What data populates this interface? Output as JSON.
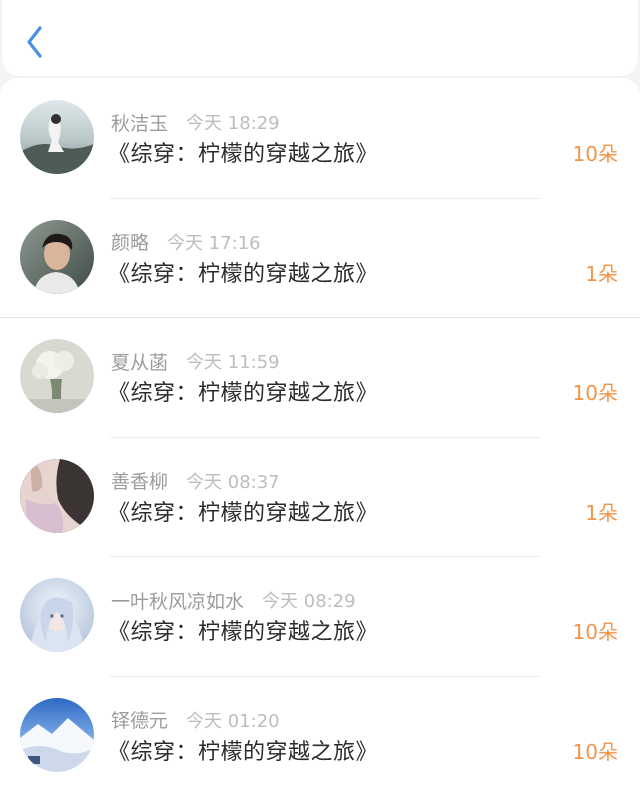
{
  "header": {
    "back_icon": "chevron-left-icon",
    "accent": "#4a90e2"
  },
  "records": [
    {
      "name": "秋洁玉",
      "time": "今天 18:29",
      "book": "《综穿：柠檬的穿越之旅》",
      "gift": "10朵"
    },
    {
      "name": "颜略",
      "time": "今天 17:16",
      "book": "《综穿：柠檬的穿越之旅》",
      "gift": "1朵"
    },
    {
      "name": "夏从菡",
      "time": "今天 11:59",
      "book": "《综穿：柠檬的穿越之旅》",
      "gift": "10朵"
    },
    {
      "name": "善香柳",
      "time": "今天 08:37",
      "book": "《综穿：柠檬的穿越之旅》",
      "gift": "1朵"
    },
    {
      "name": "一叶秋风凉如水",
      "time": "今天 08:29",
      "book": "《综穿：柠檬的穿越之旅》",
      "gift": "10朵"
    },
    {
      "name": "铎德元",
      "time": "今天 01:20",
      "book": "《综穿：柠檬的穿越之旅》",
      "gift": "10朵"
    }
  ],
  "colors": {
    "gift": "#f0954a",
    "name": "#9c9c9c",
    "time": "#bdbdbd",
    "title": "#2b2b2b"
  }
}
